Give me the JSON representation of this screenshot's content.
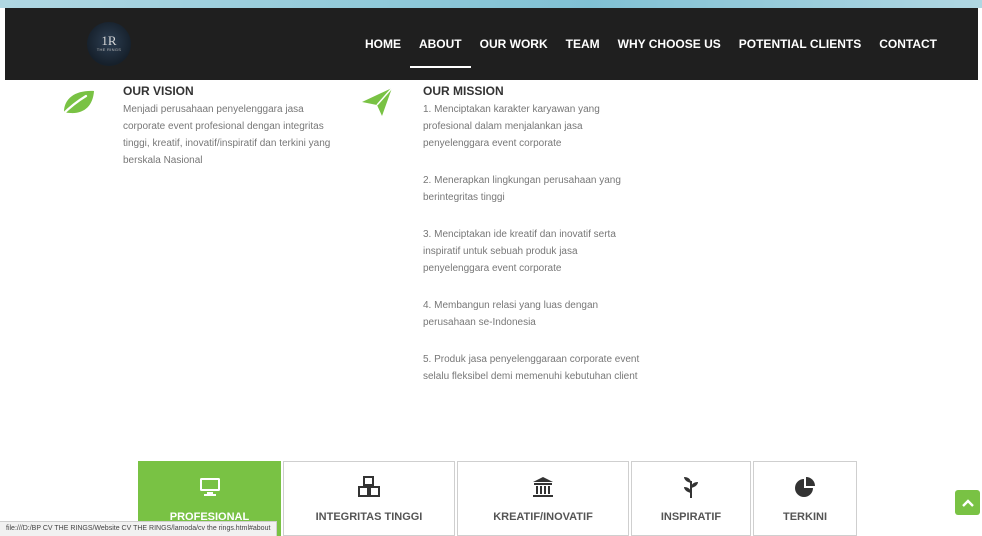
{
  "brand": {
    "logo_mark": "1R",
    "logo_sub": "THE RINGS"
  },
  "nav": {
    "items": [
      {
        "label": "HOME"
      },
      {
        "label": "ABOUT"
      },
      {
        "label": "OUR WORK"
      },
      {
        "label": "TEAM"
      },
      {
        "label": "WHY CHOOSE US"
      },
      {
        "label": "POTENTIAL CLIENTS"
      },
      {
        "label": "CONTACT"
      }
    ],
    "active": "ABOUT"
  },
  "vision": {
    "title": "OUR VISION",
    "icon": "leaf-icon",
    "text": "Menjadi perusahaan penyelenggara jasa corporate event profesional dengan integritas tinggi, kreatif, inovatif/inspiratif dan terkini yang berskala Nasional"
  },
  "mission": {
    "title": "OUR MISSION",
    "icon": "paper-plane-icon",
    "points": [
      "1. Menciptakan karakter karyawan yang profesional dalam menjalankan jasa penyelenggara event corporate",
      "2. Menerapkan lingkungan perusahaan yang berintegritas tinggi",
      "3. Menciptakan ide kreatif dan inovatif serta inspiratif untuk sebuah produk jasa penyelenggara event corporate",
      "4. Membangun relasi yang luas dengan perusahaan se-Indonesia",
      "5. Produk jasa penyelenggaraan corporate event selalu fleksibel demi memenuhi kebutuhan client"
    ]
  },
  "features": [
    {
      "label": "PROFESIONAL",
      "icon": "desktop-icon",
      "active": true
    },
    {
      "label": "INTEGRITAS TINGGI",
      "icon": "cubes-icon",
      "active": false
    },
    {
      "label": "KREATIF/INOVATIF",
      "icon": "institution-icon",
      "active": false
    },
    {
      "label": "INSPIRATIF",
      "icon": "plant-icon",
      "active": false
    },
    {
      "label": "TERKINI",
      "icon": "pie-chart-icon",
      "active": false
    }
  ],
  "status_bar": {
    "url": "file:///D:/BP CV THE RINGS/Website CV THE RINGS/lamoda/cv the rings.html#about"
  },
  "colors": {
    "accent": "#79c244",
    "navbar": "#1f1f1f",
    "text": "#777777"
  }
}
